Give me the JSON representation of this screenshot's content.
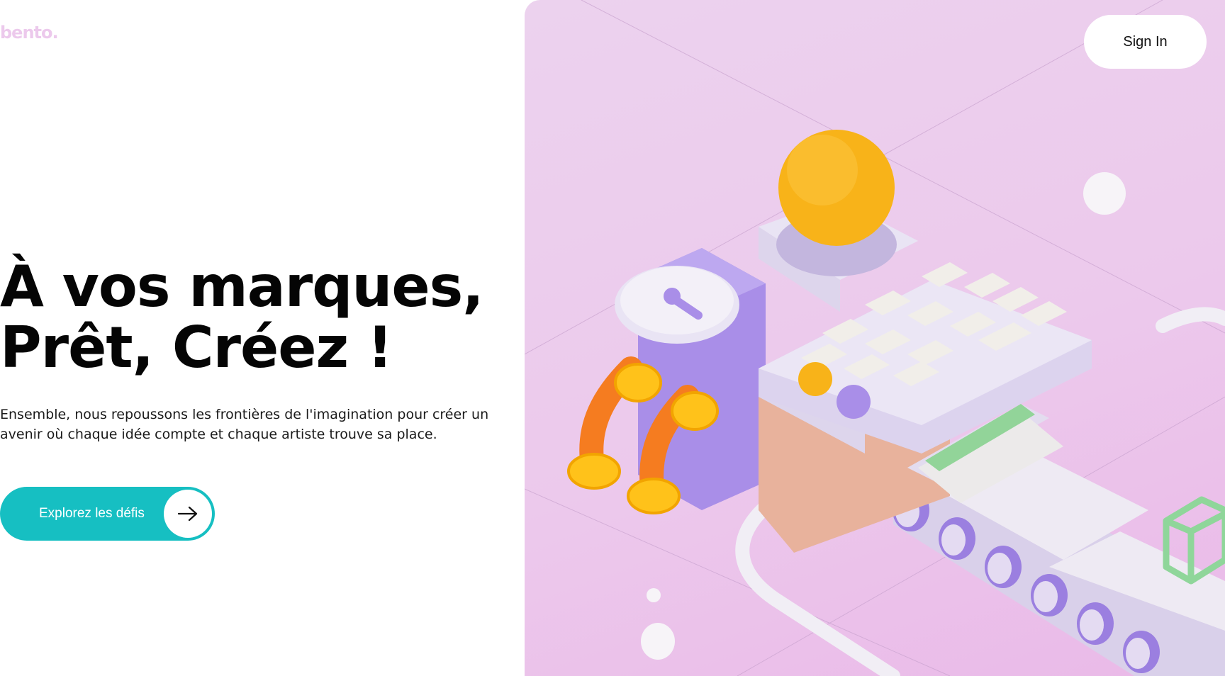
{
  "brand": {
    "logo_text": "bento."
  },
  "hero": {
    "title_line1": "À vos marques,",
    "title_line2": "Prêt, Créez !",
    "subtitle": "Ensemble, nous repoussons les frontières de l'imagination pour créer un avenir où chaque idée compte et chaque artiste trouve sa place."
  },
  "cta": {
    "label": "Explorez les défis",
    "icon": "arrow-right-icon"
  },
  "header": {
    "signin_label": "Sign In"
  },
  "colors": {
    "accent": "#16bfc2",
    "art_background": "#ecc9ec",
    "logo": "#ecc9ec"
  }
}
